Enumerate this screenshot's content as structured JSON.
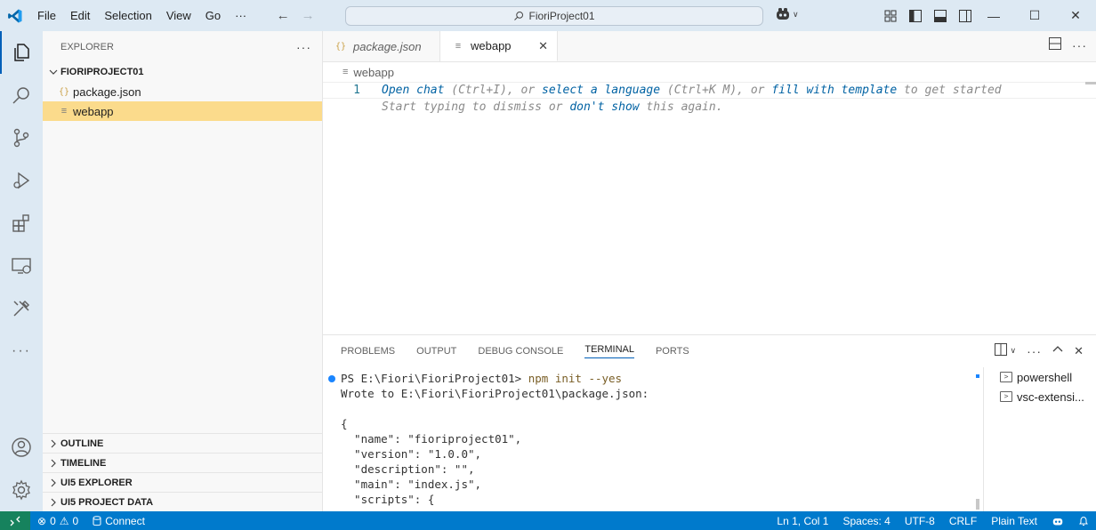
{
  "titlebar": {
    "menu": [
      "File",
      "Edit",
      "Selection",
      "View",
      "Go"
    ],
    "menu_more": "···",
    "command_center": "FioriProject01"
  },
  "sidebar": {
    "header": "EXPLORER",
    "more": "···",
    "folder": "FIORIPROJECT01",
    "files": [
      {
        "name": "package.json",
        "icon": "{}"
      },
      {
        "name": "webapp",
        "icon": "≡"
      }
    ],
    "panes": [
      "OUTLINE",
      "TIMELINE",
      "UI5 EXPLORER",
      "UI5 PROJECT DATA"
    ]
  },
  "editor": {
    "tabs": [
      {
        "label": "package.json",
        "icon": "{}"
      },
      {
        "label": "webapp",
        "icon": "≡"
      }
    ],
    "breadcrumb": "webapp",
    "line_number": "1",
    "hint_line1": {
      "open_chat": "Open chat",
      "t1": " (Ctrl+I), or ",
      "select_language": "select a language",
      "t2": " (Ctrl+K M), or ",
      "fill_template": "fill with template",
      "t3": " to get started"
    },
    "hint_line2": {
      "t1": "Start typing to dismiss or ",
      "dont_show": "don't show",
      "t2": " this again."
    }
  },
  "panel": {
    "tabs": [
      "PROBLEMS",
      "OUTPUT",
      "DEBUG CONSOLE",
      "TERMINAL",
      "PORTS"
    ],
    "active_tab": "TERMINAL",
    "terminal": {
      "prompt": "PS E:\\Fiori\\FioriProject01> ",
      "command": "npm init --yes",
      "lines": [
        "Wrote to E:\\Fiori\\FioriProject01\\package.json:",
        "",
        "{",
        "  \"name\": \"fioriproject01\",",
        "  \"version\": \"1.0.0\",",
        "  \"description\": \"\",",
        "  \"main\": \"index.js\",",
        "  \"scripts\": {"
      ]
    },
    "terminal_list": [
      "powershell",
      "vsc-extensi..."
    ]
  },
  "statusbar": {
    "errors": "0",
    "warnings": "0",
    "connect": "Connect",
    "position": "Ln 1, Col 1",
    "spaces": "Spaces: 4",
    "encoding": "UTF-8",
    "eol": "CRLF",
    "language": "Plain Text"
  },
  "colors": {
    "accent": "#005fb8",
    "statusbar": "#007acc",
    "remote": "#16825d",
    "selection": "#fbdb8c"
  }
}
